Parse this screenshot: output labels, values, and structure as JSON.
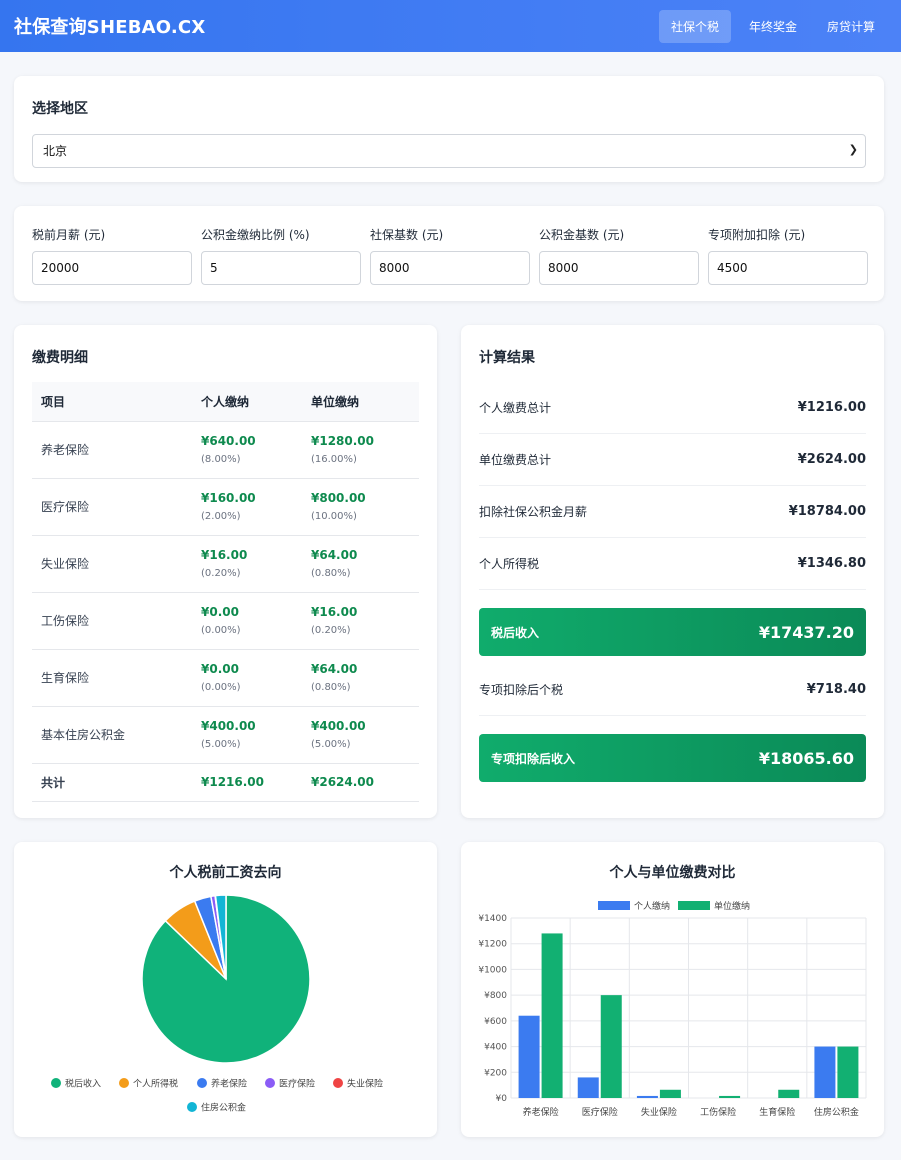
{
  "header": {
    "brand": "社保查询SHEBAO.CX",
    "nav": [
      {
        "label": "社保个税",
        "active": true
      },
      {
        "label": "年终奖金",
        "active": false
      },
      {
        "label": "房贷计算",
        "active": false
      }
    ]
  },
  "region": {
    "title": "选择地区",
    "selected": "北京"
  },
  "inputs": [
    {
      "label": "税前月薪 (元)",
      "value": "20000"
    },
    {
      "label": "公积金缴纳比例 (%)",
      "value": "5"
    },
    {
      "label": "社保基数 (元)",
      "value": "8000"
    },
    {
      "label": "公积金基数 (元)",
      "value": "8000"
    },
    {
      "label": "专项附加扣除 (元)",
      "value": "4500"
    }
  ],
  "details": {
    "title": "缴费明细",
    "headers": [
      "项目",
      "个人缴纳",
      "单位缴纳"
    ],
    "rows": [
      {
        "name": "养老保险",
        "personal": "¥640.00",
        "personal_rate": "(8.00%)",
        "company": "¥1280.00",
        "company_rate": "(16.00%)"
      },
      {
        "name": "医疗保险",
        "personal": "¥160.00",
        "personal_rate": "(2.00%)",
        "company": "¥800.00",
        "company_rate": "(10.00%)"
      },
      {
        "name": "失业保险",
        "personal": "¥16.00",
        "personal_rate": "(0.20%)",
        "company": "¥64.00",
        "company_rate": "(0.80%)"
      },
      {
        "name": "工伤保险",
        "personal": "¥0.00",
        "personal_rate": "(0.00%)",
        "company": "¥16.00",
        "company_rate": "(0.20%)"
      },
      {
        "name": "生育保险",
        "personal": "¥0.00",
        "personal_rate": "(0.00%)",
        "company": "¥64.00",
        "company_rate": "(0.80%)"
      },
      {
        "name": "基本住房公积金",
        "personal": "¥400.00",
        "personal_rate": "(5.00%)",
        "company": "¥400.00",
        "company_rate": "(5.00%)"
      }
    ],
    "total": {
      "name": "共计",
      "personal": "¥1216.00",
      "company": "¥2624.00"
    }
  },
  "results": {
    "title": "计算结果",
    "rows": [
      {
        "label": "个人缴费总计",
        "value": "¥1216.00"
      },
      {
        "label": "单位缴费总计",
        "value": "¥2624.00"
      },
      {
        "label": "扣除社保公积金月薪",
        "value": "¥18784.00"
      },
      {
        "label": "个人所得税",
        "value": "¥1346.80"
      }
    ],
    "after_tax": {
      "label": "税后收入",
      "value": "¥17437.20"
    },
    "special_tax": {
      "label": "专项扣除后个税",
      "value": "¥718.40"
    },
    "special_income": {
      "label": "专项扣除后收入",
      "value": "¥18065.60"
    }
  },
  "chart_data": [
    {
      "type": "pie",
      "title": "个人税前工资去向",
      "labels": [
        "税后收入",
        "个人所得税",
        "养老保险",
        "医疗保险",
        "失业保险",
        "住房公积金"
      ],
      "values": [
        17437.2,
        1346.8,
        640,
        160,
        16,
        400
      ],
      "colors": [
        "#10b27a",
        "#f39c1a",
        "#3b7bf0",
        "#8b5cf6",
        "#ef4444",
        "#12b5d5"
      ],
      "legend_position": "bottom"
    },
    {
      "type": "bar",
      "title": "个人与单位缴费对比",
      "categories": [
        "养老保险",
        "医疗保险",
        "失业保险",
        "工伤保险",
        "生育保险",
        "住房公积金"
      ],
      "series": [
        {
          "name": "个人缴纳",
          "values": [
            640,
            160,
            16,
            0,
            0,
            400
          ],
          "color": "#3b7bf0"
        },
        {
          "name": "单位缴纳",
          "values": [
            1280,
            800,
            64,
            16,
            64,
            400
          ],
          "color": "#12b072"
        }
      ],
      "ylim": [
        0,
        1400
      ],
      "yticks": [
        "¥0",
        "¥200",
        "¥400",
        "¥600",
        "¥800",
        "¥1000",
        "¥1200",
        "¥1400"
      ],
      "grid": true,
      "legend_position": "top"
    }
  ]
}
